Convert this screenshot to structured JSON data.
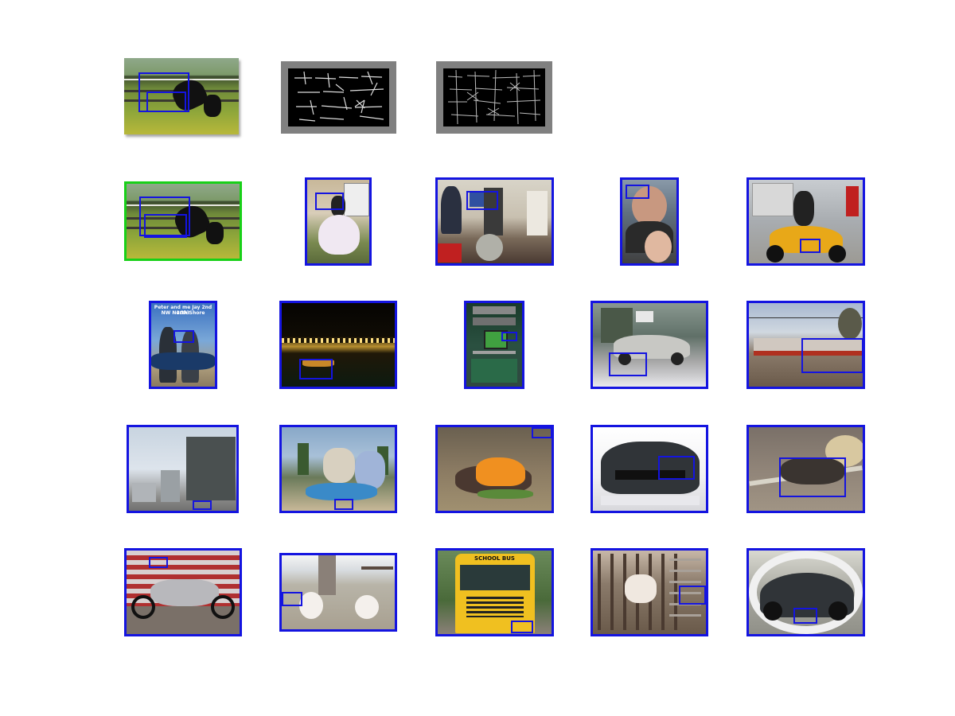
{
  "figure": {
    "frame_color": "#1414e0",
    "query_frame_color": "#18d018",
    "descriptor_frame_color": "#808080",
    "rows": [
      {
        "cells": [
          {
            "subject": "horse-query",
            "frame": "none"
          },
          {
            "subject": "hog-descriptor-positive",
            "frame": "gray"
          },
          {
            "subject": "hog-descriptor-negative",
            "frame": "gray"
          }
        ]
      },
      {
        "cells": [
          {
            "subject": "horse",
            "frame": "green"
          },
          {
            "subject": "girl-white-dress",
            "frame": "blue"
          },
          {
            "subject": "people-at-computers",
            "frame": "blue"
          },
          {
            "subject": "man-and-woman",
            "frame": "blue"
          },
          {
            "subject": "scooter-rider",
            "frame": "blue"
          }
        ]
      },
      {
        "cells": [
          {
            "subject": "couple-with-sign",
            "frame": "blue",
            "sign_text": [
              "Peter and me Jay 2nd 2003",
              "NW North Shore"
            ]
          },
          {
            "subject": "night-harbor",
            "frame": "blue"
          },
          {
            "subject": "computer-desk",
            "frame": "blue"
          },
          {
            "subject": "car-in-snow",
            "frame": "blue"
          },
          {
            "subject": "train-station",
            "frame": "blue"
          }
        ]
      },
      {
        "cells": [
          {
            "subject": "city-street",
            "frame": "blue"
          },
          {
            "subject": "couple-on-motorbike",
            "frame": "blue"
          },
          {
            "subject": "dog-orange-coat",
            "frame": "blue"
          },
          {
            "subject": "black-bmw",
            "frame": "blue"
          },
          {
            "subject": "cat-on-ironing-board",
            "frame": "blue"
          }
        ]
      },
      {
        "cells": [
          {
            "subject": "motorcycle",
            "frame": "blue"
          },
          {
            "subject": "dogs-on-beach",
            "frame": "blue"
          },
          {
            "subject": "school-bus",
            "frame": "blue",
            "sign_text": [
              "SCHOOL BUS"
            ]
          },
          {
            "subject": "cows-in-pen",
            "frame": "blue"
          },
          {
            "subject": "porsche",
            "frame": "blue"
          }
        ]
      }
    ]
  }
}
